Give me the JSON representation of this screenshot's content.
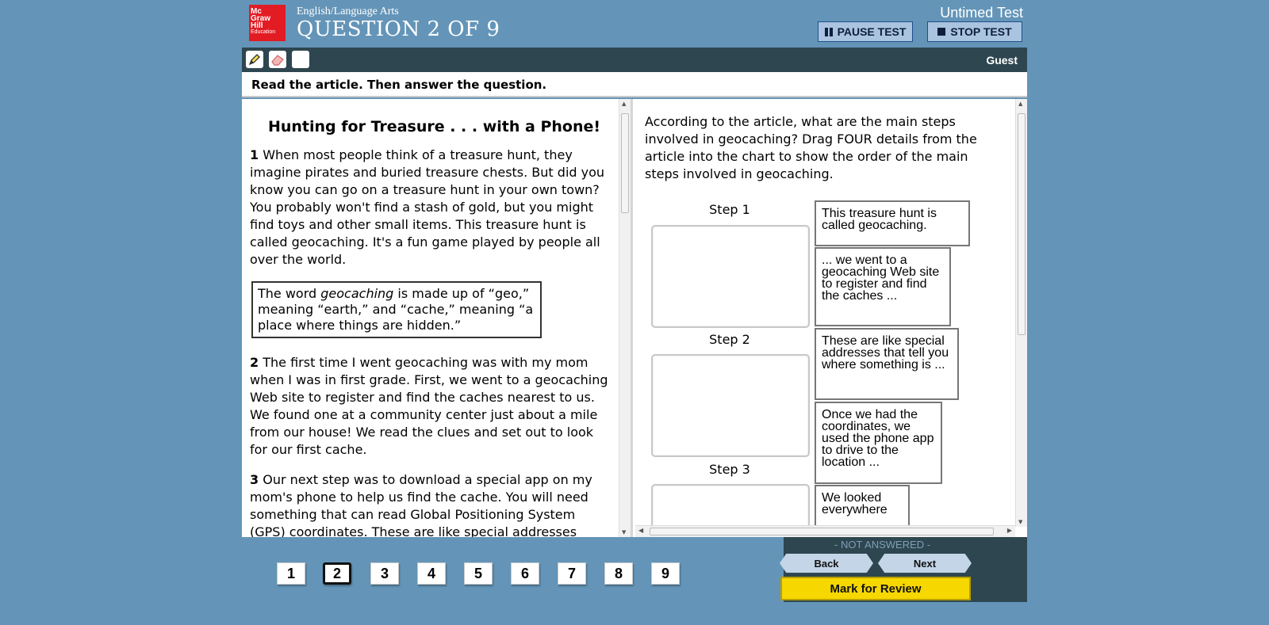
{
  "header": {
    "logo_lines": [
      "Mc",
      "Graw",
      "Hill",
      "Education"
    ],
    "subject": "English/Language Arts",
    "question_title": "QUESTION 2 OF 9",
    "timer_mode": "Untimed Test",
    "pause_label": "PAUSE TEST",
    "stop_label": "STOP TEST"
  },
  "toolbar": {
    "tools": [
      "highlighter-icon",
      "eraser-icon",
      "blank-tool-icon"
    ],
    "user": "Guest"
  },
  "instruction": "Read the article. Then answer the question.",
  "article": {
    "title": "Hunting for Treasure . . . with a Phone!",
    "p1_num": "1",
    "p1": "When most people think of a treasure hunt, they imagine pirates and buried treasure chests. But did you know you can go on a treasure hunt in your own town? You probably won't find a stash of gold, but you might find toys and other small items. This treasure hunt is called geocaching. It's a fun game played by people all over the world.",
    "def_pre": "The word ",
    "def_word": "geocaching",
    "def_post": " is made up of “geo,” meaning “earth,” and “cache,” meaning “a place where things are hidden.”",
    "p2_num": "2",
    "p2": "The first time I went geocaching was with my mom when I was in first grade. First, we went to a geocaching Web site to register and find the caches nearest to us. We found one at a community center just about a mile from our house! We read the clues and set out to look for our first cache.",
    "p3_num": "3",
    "p3": "Our next step was to download a special app on my mom's phone to help us find the cache. You will need something that can read Global Positioning System (GPS) coordinates. These are like special addresses"
  },
  "question": {
    "prompt": "According to the article, what are the main steps involved in geocaching? Drag FOUR details from the article into the chart to show the order of the main steps involved in geocaching.",
    "steps": [
      "Step 1",
      "Step 2",
      "Step 3"
    ],
    "tiles": [
      "This treasure hunt is called geocaching.",
      "... we went to a geocaching Web site to register and find the caches ...",
      "These are like special addresses that tell you where something is ...",
      "Once we had the coordinates, we used the phone app to drive to the location ...",
      "We looked everywhere"
    ]
  },
  "nav": {
    "numbers": [
      "1",
      "2",
      "3",
      "4",
      "5",
      "6",
      "7",
      "8",
      "9"
    ],
    "current": "2",
    "status": "- NOT ANSWERED -",
    "back": "Back",
    "next": "Next",
    "mark_review": "Mark for Review"
  }
}
